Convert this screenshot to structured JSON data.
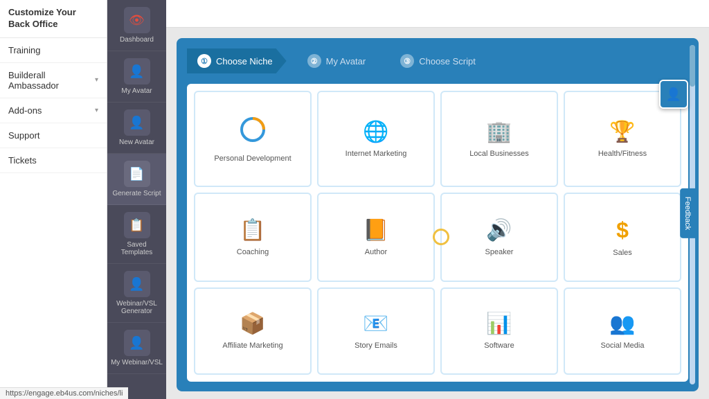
{
  "sidebar": {
    "header": "Customize Your Back Office",
    "items": [
      {
        "label": "Training",
        "hasChevron": false
      },
      {
        "label": "Builderall Ambassador",
        "hasChevron": true
      },
      {
        "label": "Add-ons",
        "hasChevron": true
      },
      {
        "label": "Support",
        "hasChevron": false
      },
      {
        "label": "Tickets",
        "hasChevron": false
      }
    ]
  },
  "iconNav": {
    "items": [
      {
        "label": "Dashboard",
        "icon": "👁",
        "active": false
      },
      {
        "label": "My Avatar",
        "icon": "👤",
        "active": false
      },
      {
        "label": "New Avatar",
        "icon": "👤",
        "active": false
      },
      {
        "label": "Generate Script",
        "icon": "📄",
        "active": true
      },
      {
        "label": "Saved Templates",
        "icon": "📋",
        "active": false
      },
      {
        "label": "Webinar/VSL Generator",
        "icon": "👤",
        "active": false
      },
      {
        "label": "My Webinar/VSL",
        "icon": "👤",
        "active": false
      }
    ]
  },
  "wizard": {
    "steps": [
      {
        "number": "①",
        "label": "Choose Niche",
        "active": true
      },
      {
        "number": "②",
        "label": "My Avatar",
        "active": false
      },
      {
        "number": "③",
        "label": "Choose Script",
        "active": false
      }
    ]
  },
  "niches": [
    {
      "label": "Personal Development",
      "icon": "🔵"
    },
    {
      "label": "Internet Marketing",
      "icon": "🌐"
    },
    {
      "label": "Local Businesses",
      "icon": "🏢"
    },
    {
      "label": "Health/Fitness",
      "icon": "🏆"
    },
    {
      "label": "Coaching",
      "icon": "📋"
    },
    {
      "label": "Author",
      "icon": "📙"
    },
    {
      "label": "Speaker",
      "icon": "🔊"
    },
    {
      "label": "Sales",
      "icon": "💲"
    },
    {
      "label": "Affiliate Marketing",
      "icon": "📦"
    },
    {
      "label": "Story Emails",
      "icon": "📧"
    },
    {
      "label": "Software",
      "icon": "📊"
    },
    {
      "label": "Social Media",
      "icon": "👥"
    }
  ],
  "feedback": {
    "label": "Feedback"
  },
  "url": "https://engage.eb4us.com/niches/li",
  "avatarBtn": {
    "icon": "👤"
  }
}
